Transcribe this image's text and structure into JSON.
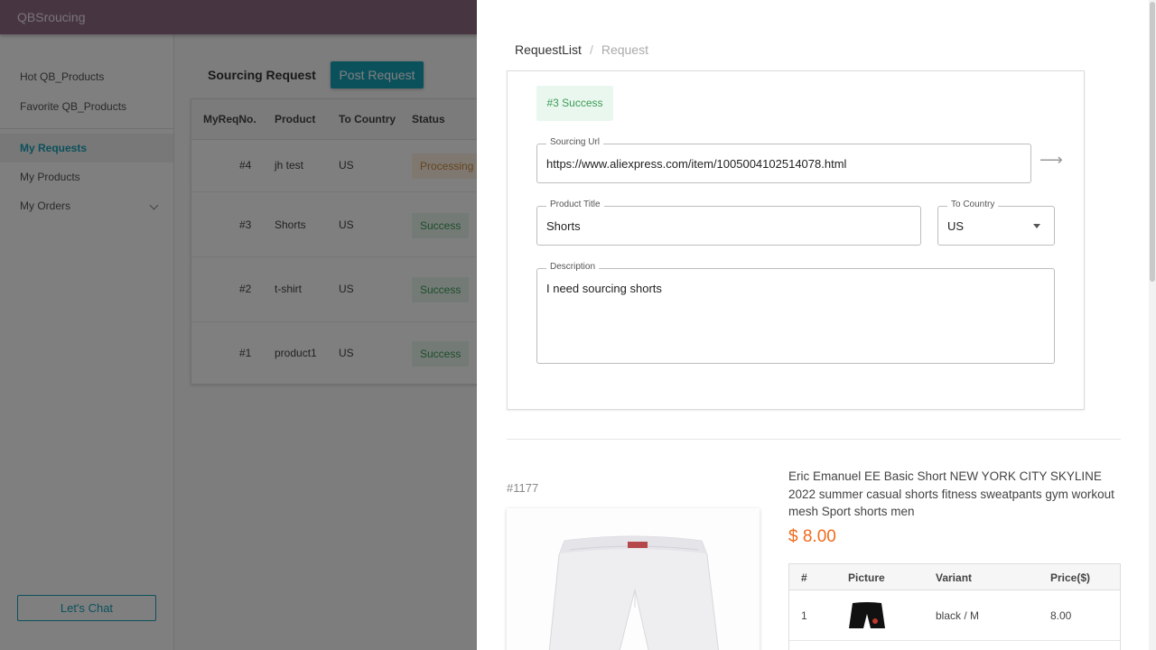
{
  "app": {
    "brand": "QBSroucing"
  },
  "sidebar": {
    "items": [
      {
        "label": "Hot QB_Products"
      },
      {
        "label": "Favorite QB_Products"
      },
      {
        "label": "My Requests"
      },
      {
        "label": "My Products"
      },
      {
        "label": "My Orders"
      }
    ],
    "chat_label": "Let's Chat"
  },
  "main": {
    "title": "Sourcing Request",
    "post_label": "Post Request",
    "columns": [
      "MyReqNo.",
      "Product",
      "To Country",
      "Status"
    ],
    "rows": [
      {
        "no": "#4",
        "product": "jh test",
        "country": "US",
        "status": "Processing"
      },
      {
        "no": "#3",
        "product": "Shorts",
        "country": "US",
        "status": "Success"
      },
      {
        "no": "#2",
        "product": "t-shirt",
        "country": "US",
        "status": "Success"
      },
      {
        "no": "#1",
        "product": "product1",
        "country": "US",
        "status": "Success"
      }
    ]
  },
  "drawer": {
    "breadcrumb": {
      "root": "RequestList",
      "sep": "/",
      "current": "Request"
    },
    "status_tag": "#3 Success",
    "sourcing_url": {
      "label": "Sourcing Url",
      "value": "https://www.aliexpress.com/item/1005004102514078.html"
    },
    "product_title": {
      "label": "Product Title",
      "value": "Shorts"
    },
    "to_country": {
      "label": "To Country",
      "value": "US"
    },
    "description": {
      "label": "Description",
      "value": "I need sourcing shorts"
    },
    "product": {
      "id": "#1177",
      "title": "Eric Emanuel EE Basic Short NEW YORK CITY SKYLINE 2022 summer casual shorts fitness sweatpants gym workout mesh Sport shorts men",
      "price": "$ 8.00",
      "variant_columns": [
        "#",
        "Picture",
        "Variant",
        "Price($)"
      ],
      "variants": [
        {
          "index": "1",
          "variant": "black / M",
          "price": "8.00"
        }
      ]
    }
  },
  "colors": {
    "appbar": "#8e6a85",
    "accent": "#17a2b8",
    "price": "#f26b1d",
    "success": "#3d9b57",
    "processing": "#c88a3a"
  },
  "icons": [
    "arrow-right-icon",
    "chevron-down-icon",
    "dropdown-arrow-icon"
  ]
}
